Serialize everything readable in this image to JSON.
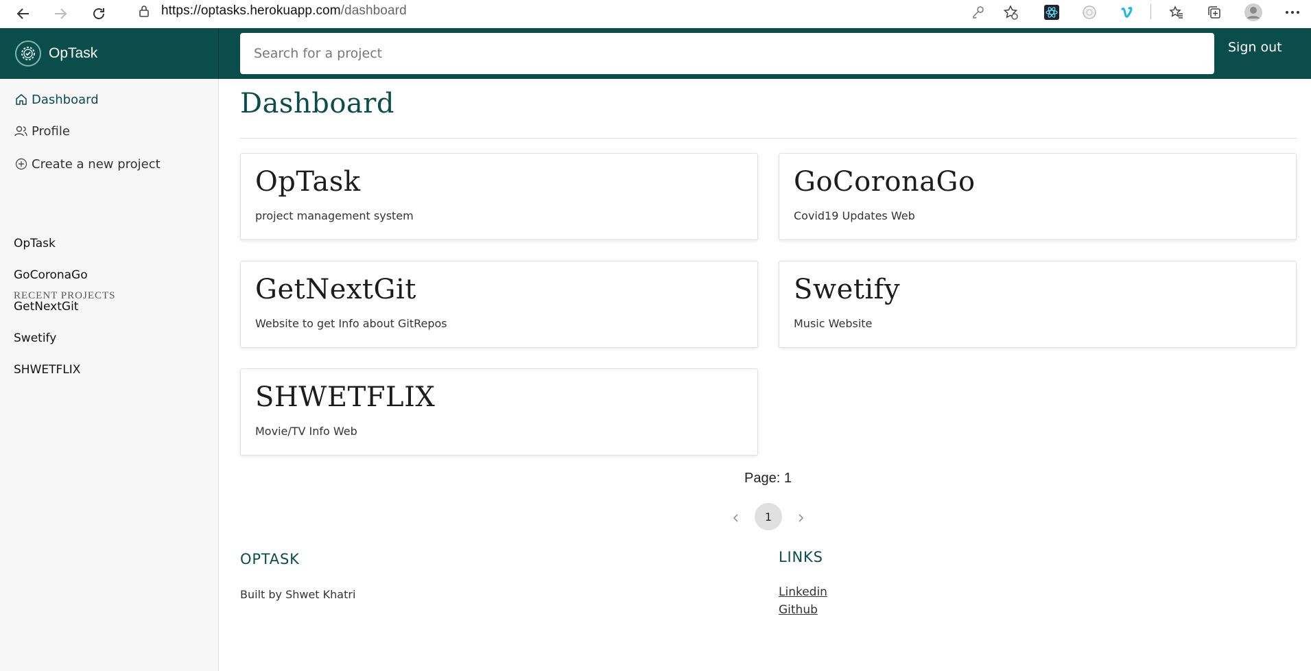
{
  "browser": {
    "url_host": "https://optasks.herokuapp.com",
    "url_path": "/dashboard"
  },
  "topbar": {
    "brand": "OpTask",
    "search_placeholder": "Search for a project",
    "signout_label": "Sign out",
    "color": "#0b4d4a"
  },
  "sidebar": {
    "nav": [
      {
        "label": "Dashboard",
        "icon": "home-icon"
      },
      {
        "label": "Profile",
        "icon": "users-icon"
      },
      {
        "label": "Create a new project",
        "icon": "plus-circle-icon"
      }
    ],
    "recent_title": "RECENT PROJECTS",
    "recent": [
      "OpTask",
      "GoCoronaGo",
      "GetNextGit",
      "Swetify",
      "SHWETFLIX"
    ]
  },
  "main": {
    "title": "Dashboard",
    "projects": [
      {
        "name": "OpTask",
        "description": "project management system"
      },
      {
        "name": "GoCoronaGo",
        "description": "Covid19 Updates Web"
      },
      {
        "name": "GetNextGit",
        "description": "Website to get Info about GitRepos"
      },
      {
        "name": "Swetify",
        "description": "Music Website"
      },
      {
        "name": "SHWETFLIX",
        "description": "Movie/TV Info Web"
      }
    ],
    "page_label": "Page: 1",
    "current_page": "1"
  },
  "footer": {
    "about_title": "OPTASK",
    "about_text": "Built by Shwet Khatri",
    "links_title": "LINKS",
    "links": [
      "Linkedin",
      "Github"
    ]
  }
}
